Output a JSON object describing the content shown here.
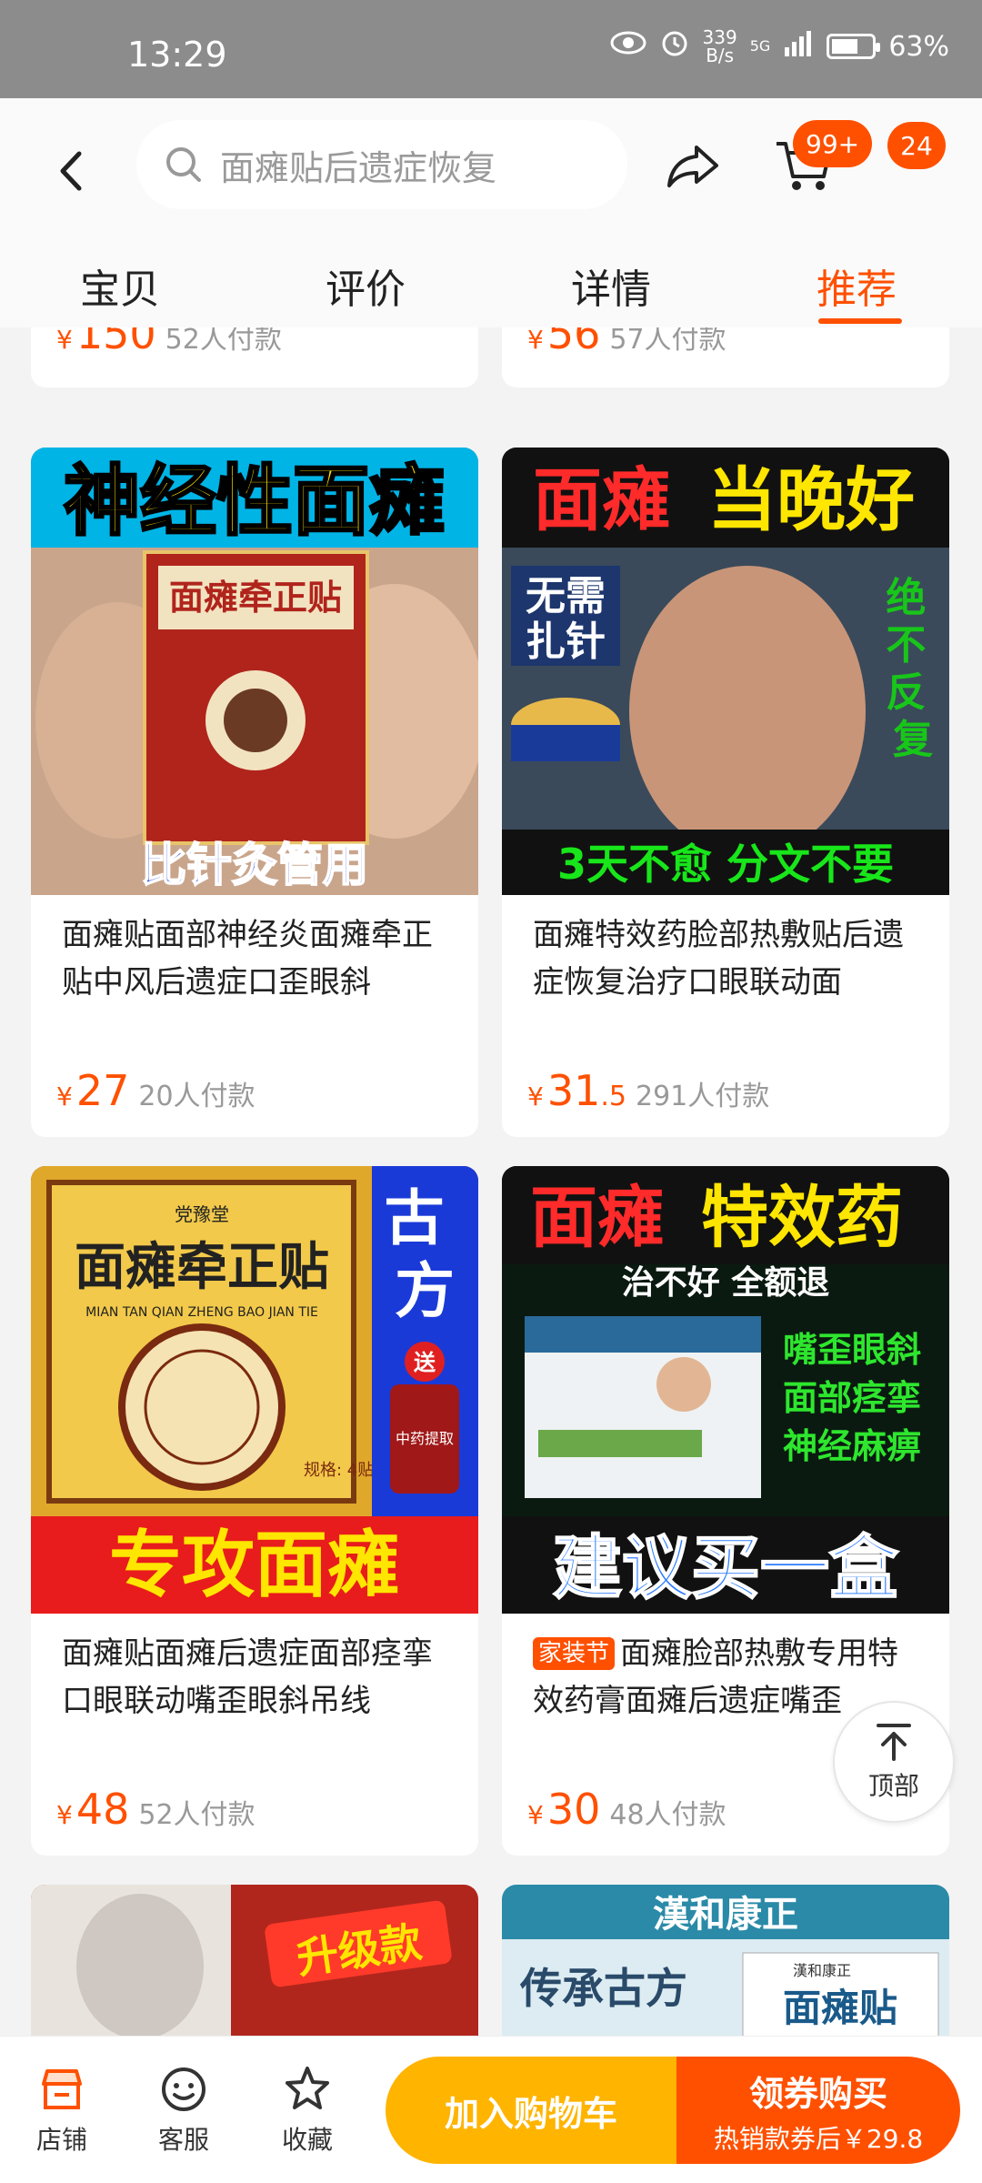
{
  "status_bar": {
    "time": "13:29",
    "net_speed_value": "339",
    "net_speed_unit": "B/s",
    "network": "5G",
    "battery": "63%"
  },
  "header": {
    "search_placeholder": "面瘫贴后遗症恢复",
    "cart_badge": "99+",
    "message_badge": "24"
  },
  "tabs": [
    "宝贝",
    "评价",
    "详情",
    "推荐"
  ],
  "active_tab": "推荐",
  "top_partial_cards": [
    {
      "price_int": "150",
      "price_dec": "",
      "paid": "52人付款"
    },
    {
      "price_int": "56",
      "price_dec": "",
      "paid": "57人付款"
    }
  ],
  "products": [
    {
      "title": "面瘫贴面部神经炎面瘫牵正贴中风后遗症口歪眼斜",
      "price_int": "27",
      "price_dec": "",
      "paid": "20人付款",
      "poster": {
        "headline": "神经性面瘫",
        "box_label": "面瘫牵正贴",
        "footer": "比针灸管用"
      }
    },
    {
      "title": "面瘫特效药脸部热敷贴后遗症恢复治疗口眼联动面",
      "price_int": "31",
      "price_dec": ".5",
      "paid": "291人付款",
      "poster": {
        "headline_a": "面瘫",
        "headline_b": "当晚好",
        "left_line1": "无需",
        "left_line2": "扎针",
        "right_text": "绝不反复",
        "footer": "3天不愈 分文不要"
      }
    },
    {
      "title": "面瘫贴面瘫后遗症面部痉挛口眼联动嘴歪眼斜吊线",
      "price_int": "48",
      "price_dec": "",
      "paid": "52人付款",
      "poster": {
        "brand": "党豫堂",
        "box_label": "面瘫牵正贴",
        "pinyin": "MIAN TAN QIAN ZHENG BAO JIAN TIE",
        "side": "古方",
        "gift": "送",
        "bottle": "中药提取",
        "spec": "规格: 4贴",
        "footer": "专攻面瘫"
      }
    },
    {
      "title": "面瘫脸部热敷专用特效药膏面瘫后遗症嘴歪",
      "tag": "家装节",
      "price_int": "30",
      "price_dec": "",
      "paid": "48人付款",
      "poster": {
        "headline_a": "面瘫",
        "headline_b": "特效药",
        "sub": "治不好 全额退",
        "line1": "嘴歪眼斜",
        "line2": "面部痉挛",
        "line3": "神经麻痹",
        "footer": "建议买一盒"
      }
    }
  ],
  "bottom_partial_posters": [
    {
      "badge": "升级款"
    },
    {
      "brand": "漢和康正",
      "text": "传承古方",
      "box_label": "面瘫贴",
      "box_brand": "漢和康正"
    }
  ],
  "to_top_label": "顶部",
  "bottom_bar": {
    "shop": "店铺",
    "service": "客服",
    "favorite": "收藏",
    "add_cart": "加入购物车",
    "buy_main": "领券购买",
    "buy_sub": "热销款券后￥29.8"
  },
  "colors": {
    "accent": "#ff5000",
    "cart_button": "#ffb400"
  }
}
